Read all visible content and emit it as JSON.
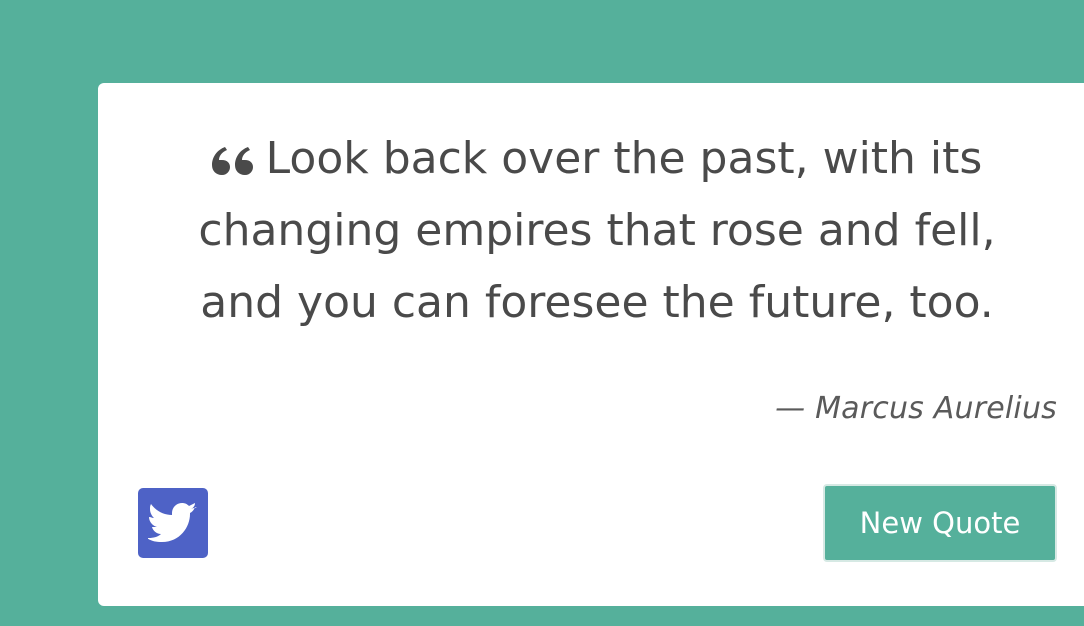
{
  "page": {
    "background_color": "#55b09b"
  },
  "quote_card": {
    "background_color": "#ffffff",
    "quote_icon": "quote-left-icon",
    "text": "Look back over the past, with its changing empires that rose and fell, and you can foresee the future, too.",
    "author": "— Marcus Aurelius"
  },
  "actions": {
    "tweet_icon": "twitter-bird-icon",
    "tweet_color": "#4e62c6",
    "new_quote_label": "New Quote",
    "new_quote_color": "#55b09b"
  }
}
